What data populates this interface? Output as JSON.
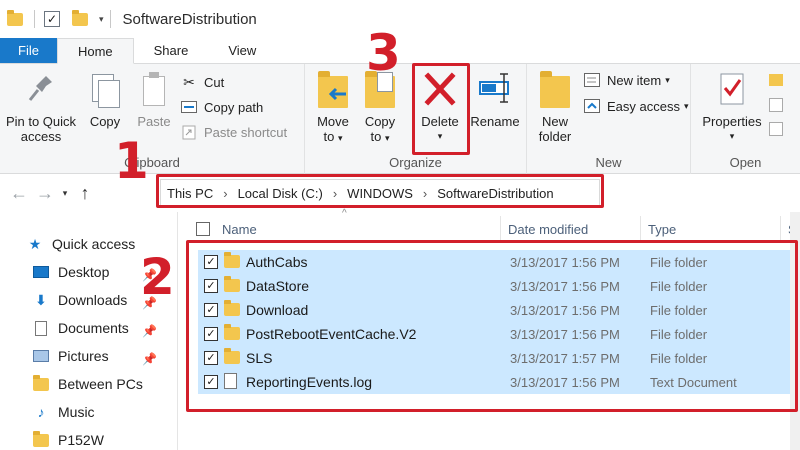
{
  "window": {
    "title": "SoftwareDistribution"
  },
  "tabs": [
    {
      "label": "File"
    },
    {
      "label": "Home"
    },
    {
      "label": "Share"
    },
    {
      "label": "View"
    }
  ],
  "clipboard": {
    "pin_label_1": "Pin to Quick",
    "pin_label_2": "access",
    "copy": "Copy",
    "paste": "Paste",
    "cut": "Cut",
    "copy_path": "Copy path",
    "paste_shortcut": "Paste shortcut",
    "group": "Clipboard"
  },
  "organize": {
    "move_1": "Move",
    "move_2": "to",
    "copy_1": "Copy",
    "copy_2": "to",
    "delete": "Delete",
    "rename": "Rename",
    "group": "Organize"
  },
  "new_group": {
    "new_folder_1": "New",
    "new_folder_2": "folder",
    "new_item": "New item",
    "easy_access": "Easy access",
    "group": "New"
  },
  "open_group": {
    "properties": "Properties",
    "group": "Open"
  },
  "breadcrumb": [
    "This PC",
    "Local Disk (C:)",
    "WINDOWS",
    "SoftwareDistribution"
  ],
  "columns": {
    "name": "Name",
    "date": "Date modified",
    "type": "Type",
    "size": "Si"
  },
  "nav": [
    {
      "label": "Quick access",
      "icon": "star-icon"
    },
    {
      "label": "Desktop",
      "icon": "desktop-icon"
    },
    {
      "label": "Downloads",
      "icon": "download-icon"
    },
    {
      "label": "Documents",
      "icon": "documents-icon"
    },
    {
      "label": "Pictures",
      "icon": "pictures-icon"
    },
    {
      "label": "Between PCs",
      "icon": "folder-icon"
    },
    {
      "label": "Music",
      "icon": "music-icon"
    },
    {
      "label": "P152W",
      "icon": "folder-icon"
    }
  ],
  "files": [
    {
      "name": "AuthCabs",
      "date": "3/13/2017 1:56 PM",
      "type": "File folder"
    },
    {
      "name": "DataStore",
      "date": "3/13/2017 1:56 PM",
      "type": "File folder"
    },
    {
      "name": "Download",
      "date": "3/13/2017 1:56 PM",
      "type": "File folder"
    },
    {
      "name": "PostRebootEventCache.V2",
      "date": "3/13/2017 1:56 PM",
      "type": "File folder"
    },
    {
      "name": "SLS",
      "date": "3/13/2017 1:57 PM",
      "type": "File folder"
    },
    {
      "name": "ReportingEvents.log",
      "date": "3/13/2017 1:56 PM",
      "type": "Text Document"
    }
  ],
  "annotations": {
    "n1": "1",
    "n2": "2",
    "n3": "3"
  },
  "colors": {
    "accent": "#1979ca",
    "annotation": "#d21f2a",
    "selection": "#cce8ff",
    "folder": "#f3c64e"
  }
}
